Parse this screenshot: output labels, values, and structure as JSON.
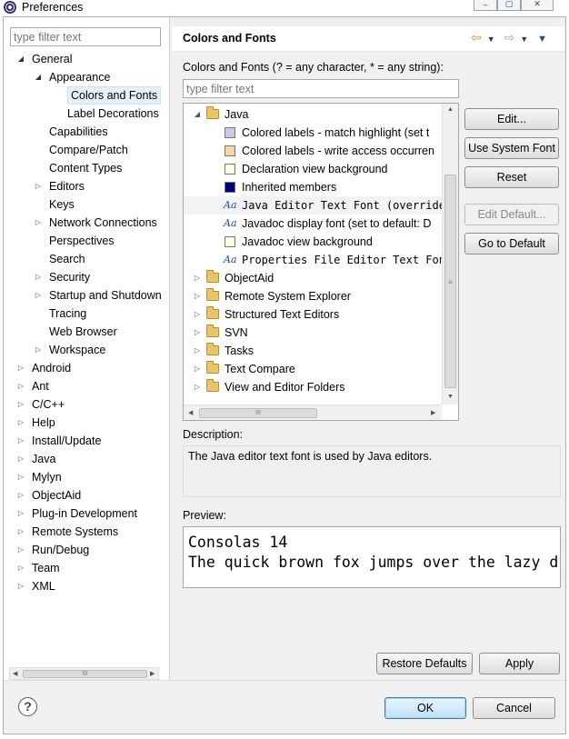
{
  "window": {
    "title": "Preferences",
    "buttons": [
      "–",
      "▢",
      "✕"
    ]
  },
  "left": {
    "filter_placeholder": "type filter text",
    "tree": [
      {
        "label": "General",
        "level": 0,
        "state": "open"
      },
      {
        "label": "Appearance",
        "level": 1,
        "state": "open"
      },
      {
        "label": "Colors and Fonts",
        "level": 2,
        "state": "leaf",
        "selected": true
      },
      {
        "label": "Label Decorations",
        "level": 2,
        "state": "leaf"
      },
      {
        "label": "Capabilities",
        "level": 1,
        "state": "leaf"
      },
      {
        "label": "Compare/Patch",
        "level": 1,
        "state": "leaf"
      },
      {
        "label": "Content Types",
        "level": 1,
        "state": "leaf"
      },
      {
        "label": "Editors",
        "level": 1,
        "state": "closed"
      },
      {
        "label": "Keys",
        "level": 1,
        "state": "leaf"
      },
      {
        "label": "Network Connections",
        "level": 1,
        "state": "closed"
      },
      {
        "label": "Perspectives",
        "level": 1,
        "state": "leaf"
      },
      {
        "label": "Search",
        "level": 1,
        "state": "leaf"
      },
      {
        "label": "Security",
        "level": 1,
        "state": "closed"
      },
      {
        "label": "Startup and Shutdown",
        "level": 1,
        "state": "closed"
      },
      {
        "label": "Tracing",
        "level": 1,
        "state": "leaf"
      },
      {
        "label": "Web Browser",
        "level": 1,
        "state": "leaf"
      },
      {
        "label": "Workspace",
        "level": 1,
        "state": "closed"
      },
      {
        "label": "Android",
        "level": 0,
        "state": "closed"
      },
      {
        "label": "Ant",
        "level": 0,
        "state": "closed"
      },
      {
        "label": "C/C++",
        "level": 0,
        "state": "closed"
      },
      {
        "label": "Help",
        "level": 0,
        "state": "closed"
      },
      {
        "label": "Install/Update",
        "level": 0,
        "state": "closed"
      },
      {
        "label": "Java",
        "level": 0,
        "state": "closed"
      },
      {
        "label": "Mylyn",
        "level": 0,
        "state": "closed"
      },
      {
        "label": "ObjectAid",
        "level": 0,
        "state": "closed"
      },
      {
        "label": "Plug-in Development",
        "level": 0,
        "state": "closed"
      },
      {
        "label": "Remote Systems",
        "level": 0,
        "state": "closed"
      },
      {
        "label": "Run/Debug",
        "level": 0,
        "state": "closed"
      },
      {
        "label": "Team",
        "level": 0,
        "state": "closed"
      },
      {
        "label": "XML",
        "level": 0,
        "state": "closed"
      }
    ]
  },
  "right": {
    "title": "Colors and Fonts",
    "hint": "Colors and Fonts (? = any character, * = any string):",
    "filter_placeholder": "type filter text",
    "tree": [
      {
        "label": "Java",
        "kind": "folder",
        "state": "open",
        "level": 0
      },
      {
        "label": "Colored labels - match highlight (set t",
        "kind": "color",
        "color": "#c8c8f0",
        "level": 1
      },
      {
        "label": "Colored labels - write access occurren",
        "kind": "color",
        "color": "#f0d8a8",
        "level": 1
      },
      {
        "label": "Declaration view background",
        "kind": "color",
        "color": "#fffde6",
        "level": 1
      },
      {
        "label": "Inherited members",
        "kind": "color",
        "color": "#000080",
        "level": 1
      },
      {
        "label": "Java Editor Text Font (overrides",
        "kind": "font",
        "mono": true,
        "selected": true,
        "level": 1
      },
      {
        "label": "Javadoc display font (set to default: D",
        "kind": "font",
        "level": 1
      },
      {
        "label": "Javadoc view background",
        "kind": "color",
        "color": "#fffde6",
        "level": 1
      },
      {
        "label": "Properties File Editor Text Font",
        "kind": "font",
        "mono": true,
        "level": 1
      },
      {
        "label": "ObjectAid",
        "kind": "folder",
        "state": "closed",
        "level": 0
      },
      {
        "label": "Remote System Explorer",
        "kind": "folder",
        "state": "closed",
        "level": 0
      },
      {
        "label": "Structured Text Editors",
        "kind": "folder",
        "state": "closed",
        "level": 0
      },
      {
        "label": "SVN",
        "kind": "folder",
        "state": "closed",
        "level": 0
      },
      {
        "label": "Tasks",
        "kind": "folder",
        "state": "closed",
        "level": 0
      },
      {
        "label": "Text Compare",
        "kind": "folder",
        "state": "closed",
        "level": 0
      },
      {
        "label": "View and Editor Folders",
        "kind": "folder",
        "state": "closed",
        "level": 0
      }
    ],
    "font_icon_glyph": "Aa",
    "buttons": {
      "edit": "Edit...",
      "use_system_font": "Use System Font",
      "reset": "Reset",
      "edit_default": "Edit Default...",
      "go_to_default": "Go to Default"
    },
    "description_label": "Description:",
    "description": "The Java editor text font is used by Java editors.",
    "preview_label": "Preview:",
    "preview_lines": [
      "Consolas 14",
      "The quick brown fox jumps over the lazy d"
    ],
    "restore_defaults": "Restore Defaults",
    "apply": "Apply"
  },
  "footer": {
    "ok": "OK",
    "cancel": "Cancel",
    "help_glyph": "?"
  },
  "scroll_glyphs": {
    "grip": "III",
    "left": "◀",
    "right": "▶",
    "up": "▲",
    "down": "▼",
    "grip_v": "≡"
  }
}
